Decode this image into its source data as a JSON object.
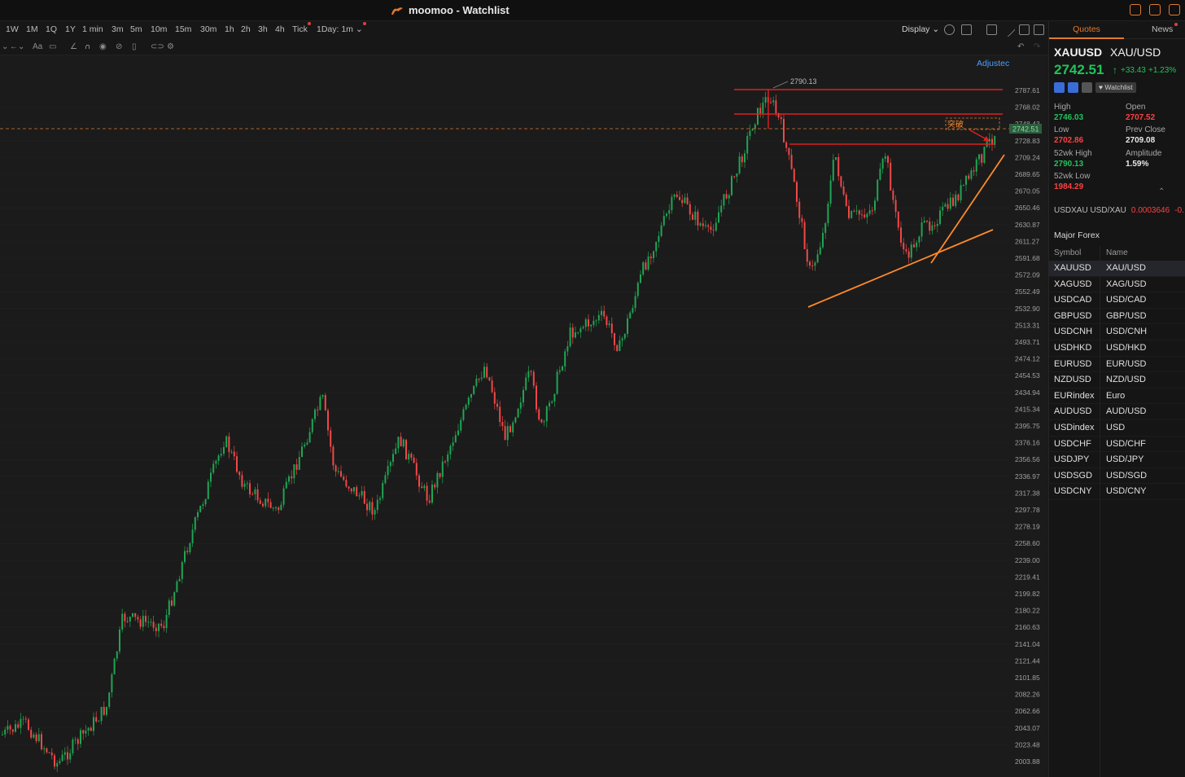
{
  "window": {
    "title": "moomoo - Watchlist"
  },
  "toolbar": {
    "timeframes": [
      "1W",
      "1M",
      "1Q",
      "1Y",
      "1 min",
      "3m",
      "5m",
      "10m",
      "15m",
      "30m",
      "1h",
      "2h",
      "3h",
      "4h",
      "Tick",
      "1Day: 1m"
    ],
    "display_label": "Display",
    "drawing_tool_glyphs": [
      "Aa"
    ]
  },
  "chart": {
    "adjusted_label": "Adjustec",
    "high_label": "2790.13",
    "annotation_text": "突破",
    "current_price_tag": "2742.51",
    "y_axis_ticks": [
      "2787.61",
      "2768.02",
      "2748.43",
      "2728.83",
      "2709.24",
      "2689.65",
      "2670.05",
      "2650.46",
      "2630.87",
      "2611.27",
      "2591.68",
      "2572.09",
      "2552.49",
      "2532.90",
      "2513.31",
      "2493.71",
      "2474.12",
      "2454.53",
      "2434.94",
      "2415.34",
      "2395.75",
      "2376.16",
      "2356.56",
      "2336.97",
      "2317.38",
      "2297.78",
      "2278.19",
      "2258.60",
      "2239.00",
      "2219.41",
      "2199.82",
      "2180.22",
      "2160.63",
      "2141.04",
      "2121.44",
      "2101.85",
      "2082.26",
      "2062.66",
      "2043.07",
      "2023.48",
      "2003.88"
    ],
    "colors": {
      "up": "#1fa553",
      "down": "#f04848",
      "resistance": "#e02020",
      "trend": "#ff8a2a"
    }
  },
  "quote": {
    "tabs": {
      "quotes": "Quotes",
      "news": "News"
    },
    "symbol": "XAUUSD",
    "name": "XAU/USD",
    "price": "2742.51",
    "change": "+33.43",
    "change_pct": "+1.23%",
    "watchlist_label": "Watchlist",
    "high_label": "High",
    "high": "2746.03",
    "open_label": "Open",
    "open": "2707.52",
    "low_label": "Low",
    "low": "2702.86",
    "prev_close_label": "Prev Close",
    "prev_close": "2709.08",
    "wk52_high_label": "52wk High",
    "wk52_high": "2790.13",
    "amplitude_label": "Amplitude",
    "amplitude": "1.59%",
    "wk52_low_label": "52wk Low",
    "wk52_low": "1984.29",
    "usdxau_label": "USDXAU USD/XAU",
    "usdxau_value": "0.0003646",
    "usdxau_change": "-0."
  },
  "forex": {
    "title": "Major Forex",
    "col_symbol": "Symbol",
    "col_name": "Name",
    "rows": [
      {
        "symbol": "XAUUSD",
        "name": "XAU/USD"
      },
      {
        "symbol": "XAGUSD",
        "name": "XAG/USD"
      },
      {
        "symbol": "USDCAD",
        "name": "USD/CAD"
      },
      {
        "symbol": "GBPUSD",
        "name": "GBP/USD"
      },
      {
        "symbol": "USDCNH",
        "name": "USD/CNH"
      },
      {
        "symbol": "USDHKD",
        "name": "USD/HKD"
      },
      {
        "symbol": "EURUSD",
        "name": "EUR/USD"
      },
      {
        "symbol": "NZDUSD",
        "name": "NZD/USD"
      },
      {
        "symbol": "EURindex",
        "name": "Euro"
      },
      {
        "symbol": "AUDUSD",
        "name": "AUD/USD"
      },
      {
        "symbol": "USDindex",
        "name": "USD"
      },
      {
        "symbol": "USDCHF",
        "name": "USD/CHF"
      },
      {
        "symbol": "USDJPY",
        "name": "USD/JPY"
      },
      {
        "symbol": "USDSGD",
        "name": "USD/SGD"
      },
      {
        "symbol": "USDCNY",
        "name": "USD/CNY"
      }
    ]
  }
}
